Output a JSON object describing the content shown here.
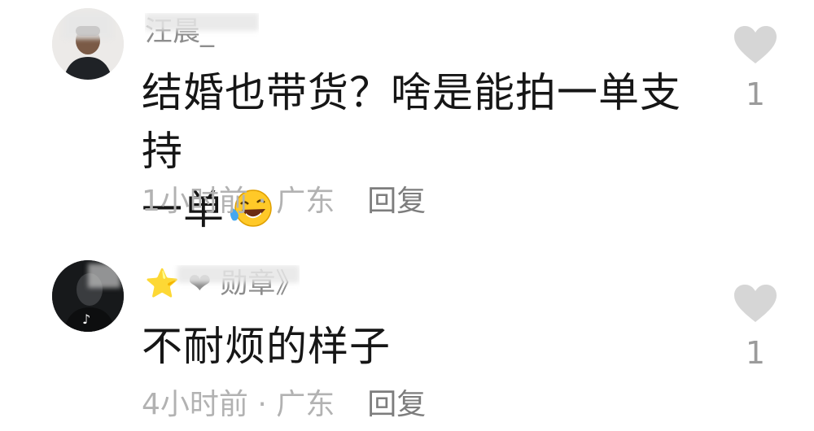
{
  "comments": [
    {
      "username": "汪晨_",
      "content_line1": "结婚也带货？啥是能拍一单支持",
      "content_line2": "一单",
      "emoji": "laughing-crying-emoji",
      "time": "1小时前",
      "separator": " · ",
      "location": "广东",
      "reply_label": "回复",
      "like_count": "1"
    },
    {
      "username": "⭐ ❤ 勋章》",
      "content_line1": "不耐烦的样子",
      "time": "4小时前",
      "separator": " · ",
      "location": "广东",
      "reply_label": "回复",
      "like_count": "1"
    }
  ],
  "colors": {
    "text": "#161616",
    "meta": "#b2b2b2",
    "reply": "#7d7d7d",
    "heart": "#d6d6d6"
  }
}
